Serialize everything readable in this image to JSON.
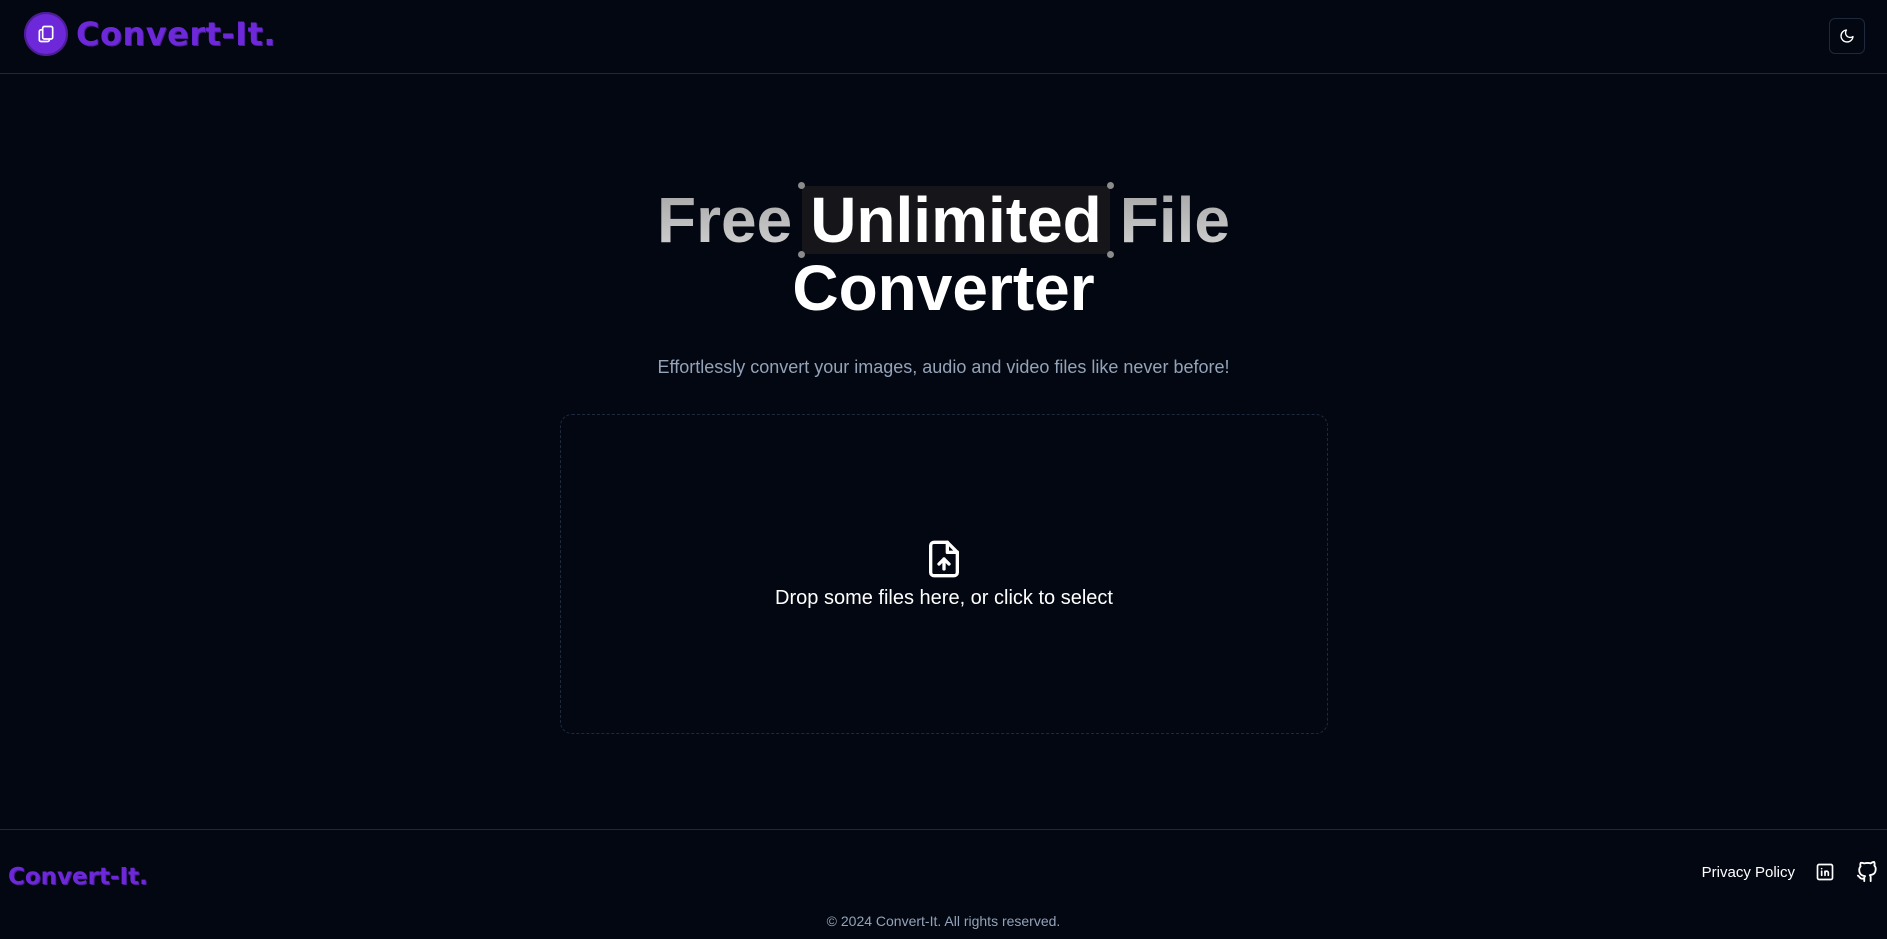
{
  "header": {
    "brand_name": "Convert-It.",
    "brand_icon": "files-icon",
    "theme_toggle_icon": "moon-icon"
  },
  "hero": {
    "title_word1": "Free",
    "title_highlight": "Unlimited",
    "title_word3": "File",
    "title_line2": "Converter",
    "subtitle": "Effortlessly convert your images, audio and video files like never before!"
  },
  "dropzone": {
    "icon": "file-upload-icon",
    "label": "Drop some files here, or click to select"
  },
  "footer": {
    "brand_name": "Convert-It.",
    "privacy_label": "Privacy Policy",
    "linkedin_icon": "linkedin-icon",
    "github_icon": "github-icon",
    "copyright": "© 2024 Convert-It. All rights reserved."
  },
  "colors": {
    "background": "#030711",
    "brand": "#6d28d9",
    "border": "#1e293b",
    "muted_text": "#94a3b8"
  }
}
